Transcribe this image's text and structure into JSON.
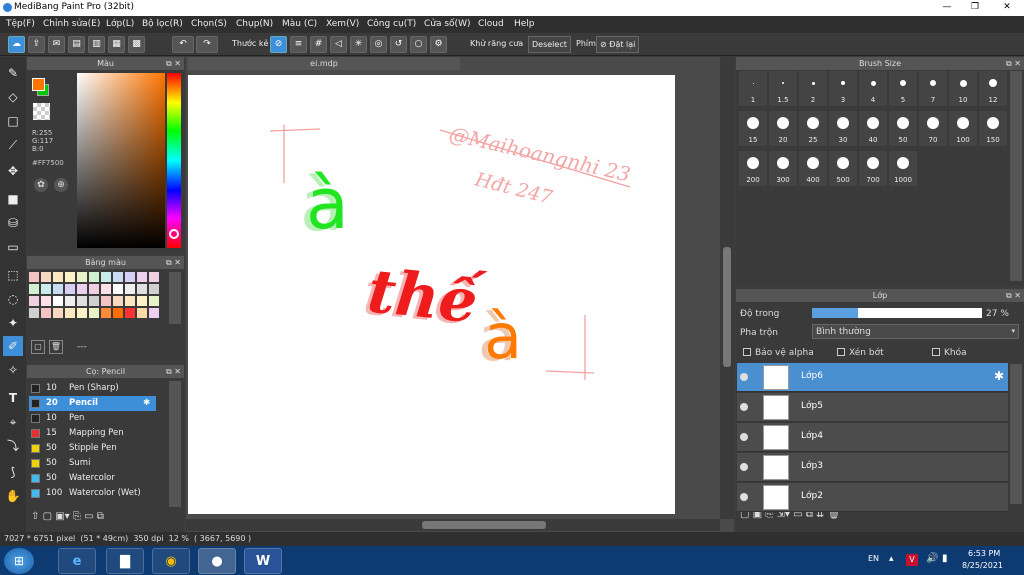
{
  "window": {
    "title": "MediBang Paint Pro (32bit)",
    "min": "—",
    "max": "❐",
    "close": "✕"
  },
  "menu": [
    "Tệp(F)",
    "Chỉnh sửa(E)",
    "Lớp(L)",
    "Bộ lọc(R)",
    "Chọn(S)",
    "Chụp(N)",
    "Màu (C)",
    "Xem(V)",
    "Công cụ(T)",
    "Cửa số(W)",
    "Cloud",
    "Help"
  ],
  "toolbar": {
    "ruler_label": "Thước kẻ",
    "antialias_label": "Khử răng cưa",
    "deselect_label": "Deselect",
    "keys_label": "Phím",
    "reset_label": "Đặt lại"
  },
  "color_panel": {
    "title": "Màu",
    "r": "R:255",
    "g": "G:117",
    "b": "B:0",
    "hex": "#FF7500",
    "fg": "#FF7500",
    "bg": "#00c800"
  },
  "palette": {
    "title": "Bảng màu",
    "ellipsis": "---"
  },
  "brush_panel": {
    "title": "Cọ: Pencil",
    "brushes": [
      {
        "size": "10",
        "name": "Pen (Sharp)",
        "color": "#222222"
      },
      {
        "size": "20",
        "name": "Pencil",
        "color": "#222222"
      },
      {
        "size": "10",
        "name": "Pen",
        "color": "#222222"
      },
      {
        "size": "15",
        "name": "Mapping Pen",
        "color": "#e83030"
      },
      {
        "size": "50",
        "name": "Stipple Pen",
        "color": "#f0d000"
      },
      {
        "size": "50",
        "name": "Sumi",
        "color": "#f0d000"
      },
      {
        "size": "50",
        "name": "Watercolor",
        "color": "#44b8f0"
      },
      {
        "size": "100",
        "name": "Watercolor (Wet)",
        "color": "#44b8f0"
      }
    ]
  },
  "canvas": {
    "tab": "ei.mdp",
    "watermark1": "@Maihoangnhi 23",
    "watermark2": "Hđt 247",
    "letters": {
      "a1": "à",
      "the": "thế",
      "a2": "à"
    }
  },
  "brush_size": {
    "title": "Brush Size",
    "sizes": [
      "1",
      "1.5",
      "2",
      "3",
      "4",
      "5",
      "7",
      "10",
      "12",
      "15",
      "20",
      "25",
      "30",
      "40",
      "50",
      "70",
      "100",
      "150",
      "200",
      "300",
      "400",
      "500",
      "700",
      "1000"
    ]
  },
  "layers": {
    "title": "Lớp",
    "opacity_label": "Độ trong",
    "opacity_value": "27 %",
    "opacity_fraction": 0.27,
    "blend_label": "Pha trộn",
    "blend_value": "Bình thường",
    "protect_alpha": "Bảo vệ alpha",
    "clipping": "Xén bớt",
    "lock": "Khóa",
    "items": [
      "Lớp6",
      "Lớp5",
      "Lớp4",
      "Lớp3",
      "Lớp2"
    ]
  },
  "status": "7027 * 6751 pixel  (51 * 49cm)  350 dpi  12 %  ( 3667, 5690 )",
  "taskbar": {
    "lang": "EN",
    "time": "6:53 PM",
    "date": "8/25/2021"
  }
}
